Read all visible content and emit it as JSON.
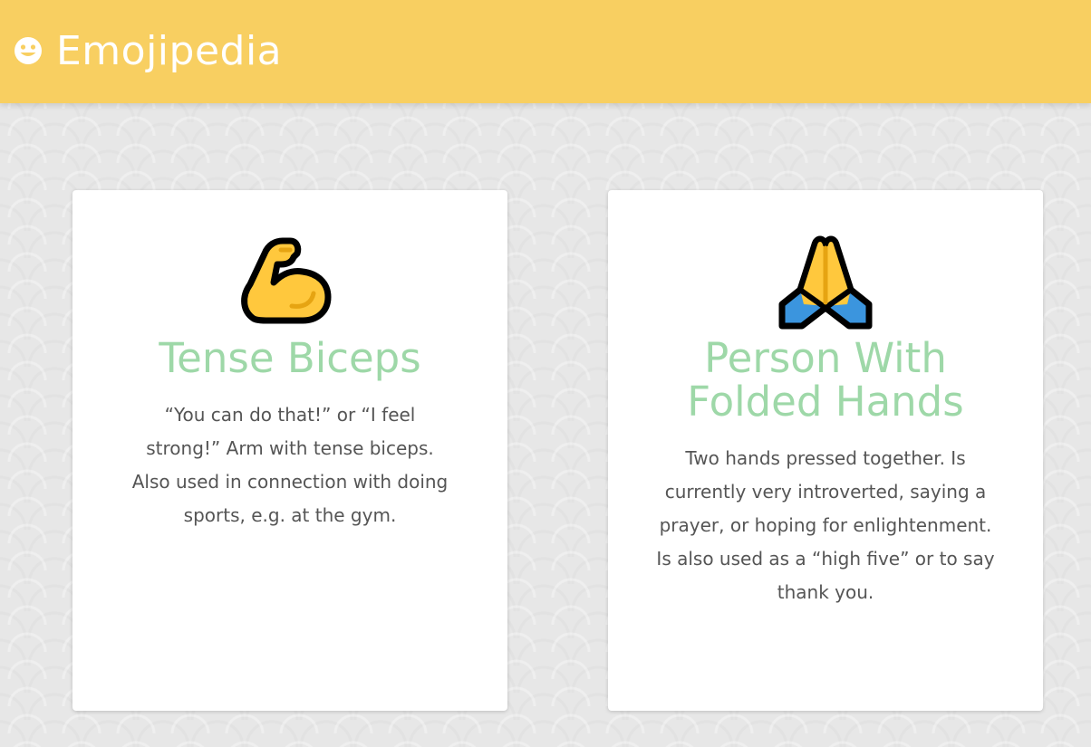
{
  "header": {
    "brand": "Emojipedia",
    "logo_icon": "smiley-icon",
    "background_color": "#f8cf61"
  },
  "cards": [
    {
      "icon": "flexed-biceps-icon",
      "title": "Tense Biceps",
      "description": "“You can do that!” or “I feel strong!” Arm with tense biceps. Also used in connection with doing sports, e.g. at the gym."
    },
    {
      "icon": "folded-hands-icon",
      "title": "Person With Folded Hands",
      "description": "Two hands pressed together. Is currently very introverted, saying a prayer, or hoping for enlightenment. Is also used as a “high five” or to say thank you."
    }
  ],
  "colors": {
    "title": "#9ed8a8",
    "text": "#555555",
    "emoji_yellow": "#ffc83d",
    "emoji_blue": "#3b95de"
  }
}
